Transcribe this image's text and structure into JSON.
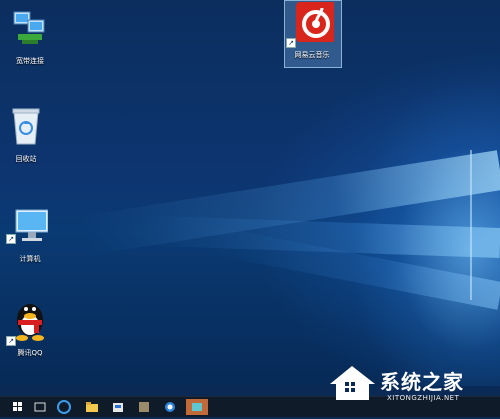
{
  "desktop": {
    "icons": [
      {
        "label": "宽带连接",
        "icon": "network-computers-icon"
      },
      {
        "label": "回收站",
        "icon": "recycle-bin-icon"
      },
      {
        "label": "计算机",
        "icon": "monitor-icon"
      },
      {
        "label": "腾讯QQ",
        "icon": "qq-penguin-icon"
      },
      {
        "label": "网易云音乐",
        "icon": "netease-music-icon",
        "selected": true
      }
    ],
    "colors": {
      "brand_red": "#d9261c",
      "selection": "#6ea2d8"
    }
  },
  "taskbar": {
    "items": [
      "windows-start-icon",
      "task-view-icon",
      "edge-icon",
      "file-explorer-icon",
      "store-icon",
      "app-icon",
      "search-app-icon",
      "active-app-icon"
    ]
  },
  "watermark": {
    "text": "系统之家",
    "url": "XITONGZHIJIA.NET"
  }
}
